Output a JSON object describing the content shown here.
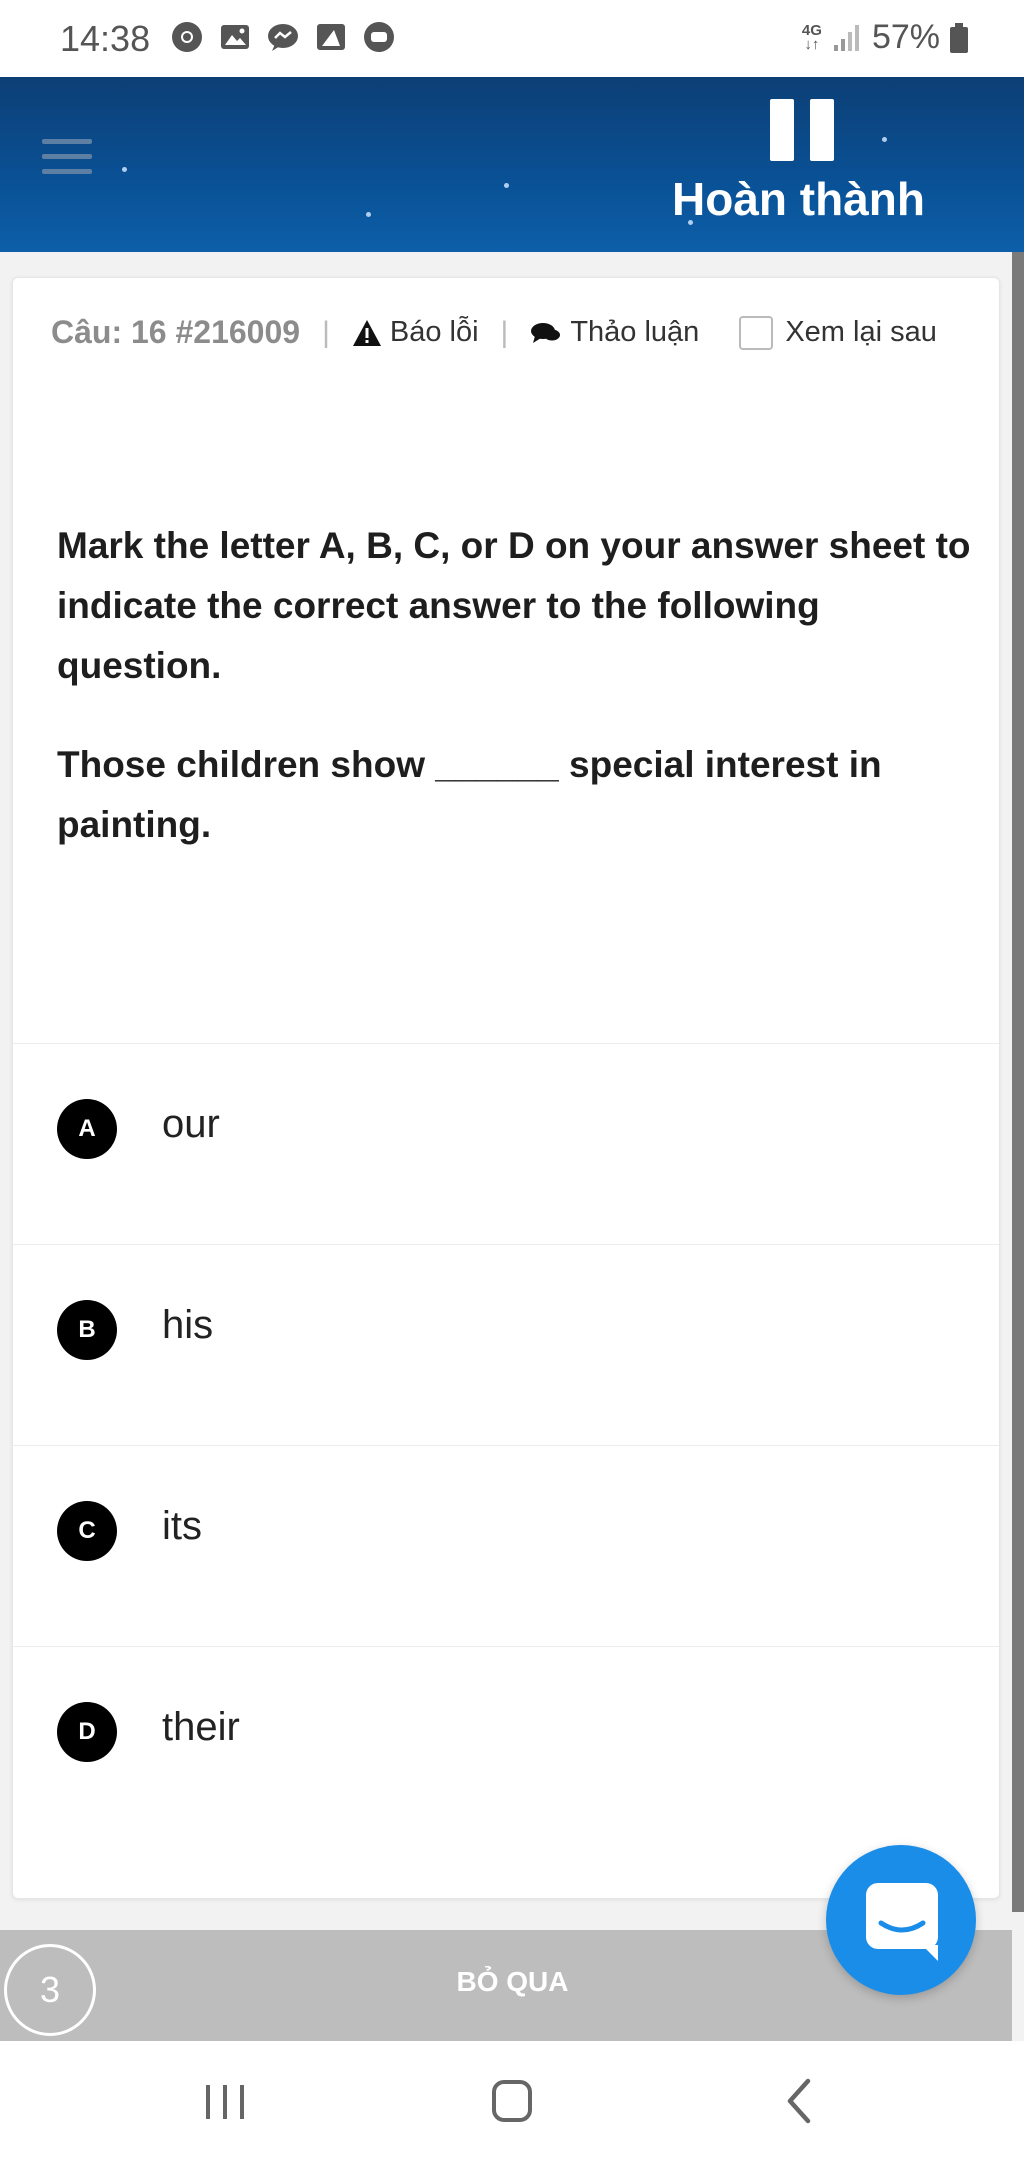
{
  "status_bar": {
    "time": "14:38",
    "notification_icons": [
      "chrome-icon",
      "gallery-icon",
      "messenger-icon",
      "image-edit-icon",
      "chat-bubble-icon"
    ],
    "network_label": "4G",
    "battery_percent": "57%"
  },
  "header": {
    "menu_icon": "hamburger-icon",
    "pause_icon": "pause-icon",
    "finish_label": "Hoàn thành"
  },
  "question_meta": {
    "number_label": "Câu: 16 #216009",
    "report_label": "Báo lỗi",
    "discuss_label": "Thảo luận",
    "review_later_label": "Xem lại sau",
    "review_later_checked": false
  },
  "question": {
    "instruction": "Mark the letter A, B, C, or D on your answer sheet to indicate the correct answer to the following question.",
    "prompt": "Those children show ______ special interest in painting."
  },
  "options": [
    {
      "letter": "A",
      "text": "our"
    },
    {
      "letter": "B",
      "text": "his"
    },
    {
      "letter": "C",
      "text": "its"
    },
    {
      "letter": "D",
      "text": "their"
    }
  ],
  "action_bar": {
    "counter": "3",
    "skip_label": "BỎ QUA"
  },
  "chat_button_icon": "chat-icon",
  "nav_bar": {
    "recent_icon": "recent-apps-icon",
    "home_icon": "home-icon",
    "back_icon": "back-icon"
  },
  "colors": {
    "header_top": "#0d3f75",
    "header_bottom": "#0c5fa8",
    "chat_button": "#1a8de9",
    "action_bar": "#bdbdbd"
  }
}
